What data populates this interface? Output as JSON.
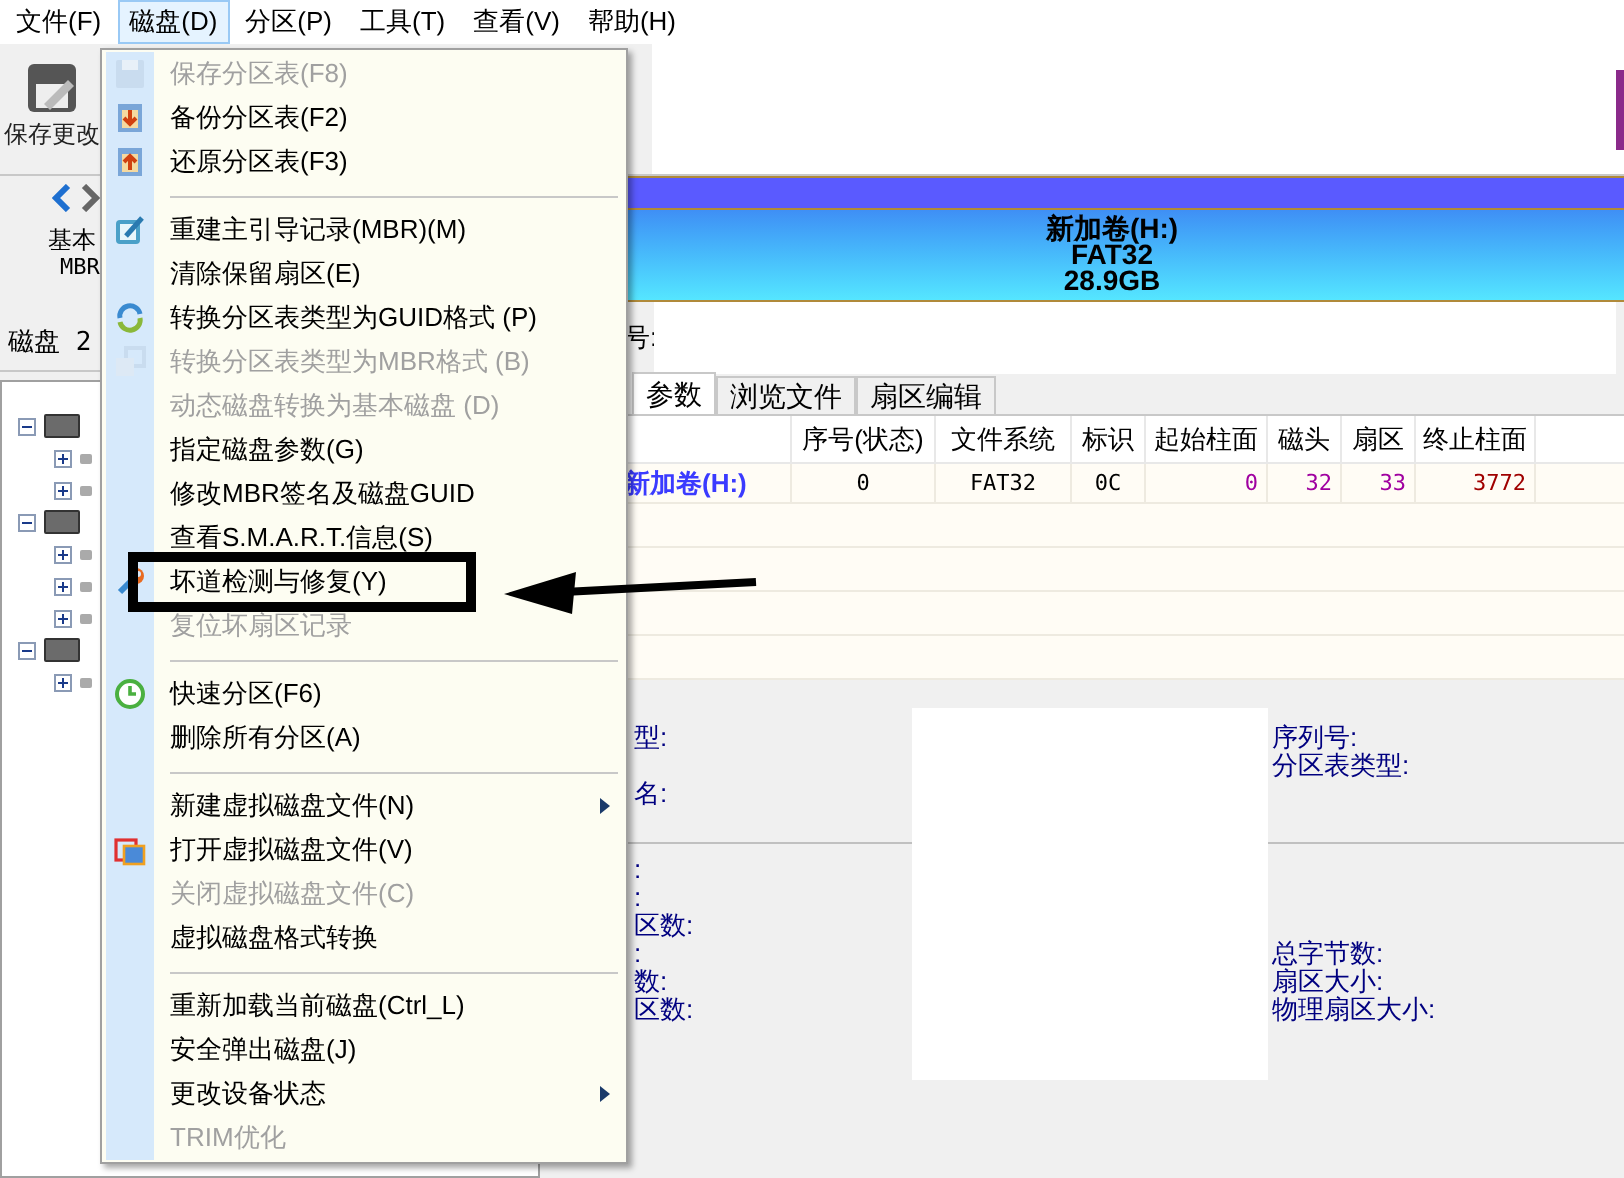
{
  "menu_bar": [
    {
      "label": "文件(F)",
      "selected": false
    },
    {
      "label": "磁盘(D)",
      "selected": true
    },
    {
      "label": "分区(P)",
      "selected": false
    },
    {
      "label": "工具(T)",
      "selected": false
    },
    {
      "label": "查看(V)",
      "selected": false
    },
    {
      "label": "帮助(H)",
      "selected": false
    }
  ],
  "toolbar": {
    "save_label": "保存更改"
  },
  "disk_nav": {
    "type_label": "基本",
    "scheme_label": "MBR",
    "disk_label": "磁盘 2"
  },
  "tree": [
    {
      "expanded": true,
      "children": [
        {
          "expanded": false
        },
        {
          "expanded": false
        }
      ]
    },
    {
      "expanded": true,
      "children": [
        {
          "expanded": false
        },
        {
          "expanded": false
        },
        {
          "expanded": false
        }
      ]
    },
    {
      "expanded": true,
      "children": [
        {
          "expanded": false
        }
      ]
    }
  ],
  "partition_bar": {
    "name": "新加卷(H:)",
    "filesystem": "FAT32",
    "size": "28.9GB"
  },
  "disk_info_label": "号:",
  "tabs": [
    {
      "label": "参数",
      "selected": true
    },
    {
      "label": "浏览文件",
      "selected": false
    },
    {
      "label": "扇区编辑",
      "selected": false
    }
  ],
  "table": {
    "columns": [
      "序号(状态)",
      "文件系统",
      "标识",
      "起始柱面",
      "磁头",
      "扇区",
      "终止柱面"
    ],
    "rows": [
      {
        "name": "新加卷(H:)",
        "cells": [
          "0",
          "FAT32",
          "0C",
          "0",
          "32",
          "33",
          "3772"
        ]
      }
    ]
  },
  "info": {
    "upper_left": [
      "型:",
      "名:"
    ],
    "upper_right": [
      "序列号:",
      "分区表类型:"
    ],
    "lower_left": [
      ":",
      ":",
      "区数:",
      ":",
      "数:",
      "区数:"
    ],
    "lower_right": [
      "总字节数:",
      "扇区大小:",
      "物理扇区大小:"
    ]
  },
  "disk_menu": [
    {
      "kind": "item",
      "label": "保存分区表(F8)",
      "disabled": true,
      "submenu": false,
      "annotated": false
    },
    {
      "kind": "item",
      "label": "备份分区表(F2)",
      "disabled": false,
      "submenu": false,
      "annotated": false
    },
    {
      "kind": "item",
      "label": "还原分区表(F3)",
      "disabled": false,
      "submenu": false,
      "annotated": false
    },
    {
      "kind": "separator"
    },
    {
      "kind": "item",
      "label": "重建主引导记录(MBR)(M)",
      "disabled": false,
      "submenu": false,
      "annotated": false
    },
    {
      "kind": "item",
      "label": "清除保留扇区(E)",
      "disabled": false,
      "submenu": false,
      "annotated": false
    },
    {
      "kind": "item",
      "label": "转换分区表类型为GUID格式 (P)",
      "disabled": false,
      "submenu": false,
      "annotated": false
    },
    {
      "kind": "item",
      "label": "转换分区表类型为MBR格式 (B)",
      "disabled": true,
      "submenu": false,
      "annotated": false
    },
    {
      "kind": "item",
      "label": "动态磁盘转换为基本磁盘 (D)",
      "disabled": true,
      "submenu": false,
      "annotated": false
    },
    {
      "kind": "item",
      "label": "指定磁盘参数(G)",
      "disabled": false,
      "submenu": false,
      "annotated": false
    },
    {
      "kind": "item",
      "label": "修改MBR签名及磁盘GUID",
      "disabled": false,
      "submenu": false,
      "annotated": false
    },
    {
      "kind": "item",
      "label": "查看S.M.A.R.T.信息(S)",
      "disabled": false,
      "submenu": false,
      "annotated": false
    },
    {
      "kind": "item",
      "label": "坏道检测与修复(Y)",
      "disabled": false,
      "submenu": false,
      "annotated": true
    },
    {
      "kind": "item",
      "label": "复位坏扇区记录",
      "disabled": true,
      "submenu": false,
      "annotated": false
    },
    {
      "kind": "separator"
    },
    {
      "kind": "item",
      "label": "快速分区(F6)",
      "disabled": false,
      "submenu": false,
      "annotated": false
    },
    {
      "kind": "item",
      "label": "删除所有分区(A)",
      "disabled": false,
      "submenu": false,
      "annotated": false
    },
    {
      "kind": "separator"
    },
    {
      "kind": "item",
      "label": "新建虚拟磁盘文件(N)",
      "disabled": false,
      "submenu": true,
      "annotated": false
    },
    {
      "kind": "item",
      "label": "打开虚拟磁盘文件(V)",
      "disabled": false,
      "submenu": false,
      "annotated": false
    },
    {
      "kind": "item",
      "label": "关闭虚拟磁盘文件(C)",
      "disabled": true,
      "submenu": false,
      "annotated": false
    },
    {
      "kind": "item",
      "label": "虚拟磁盘格式转换",
      "disabled": false,
      "submenu": false,
      "annotated": false
    },
    {
      "kind": "separator"
    },
    {
      "kind": "item",
      "label": "重新加载当前磁盘(Ctrl_L)",
      "disabled": false,
      "submenu": false,
      "annotated": false
    },
    {
      "kind": "item",
      "label": "安全弹出磁盘(J)",
      "disabled": false,
      "submenu": false,
      "annotated": false
    },
    {
      "kind": "item",
      "label": "更改设备状态",
      "disabled": false,
      "submenu": true,
      "annotated": false
    },
    {
      "kind": "item",
      "label": "TRIM优化",
      "disabled": true,
      "submenu": false,
      "annotated": false
    }
  ]
}
